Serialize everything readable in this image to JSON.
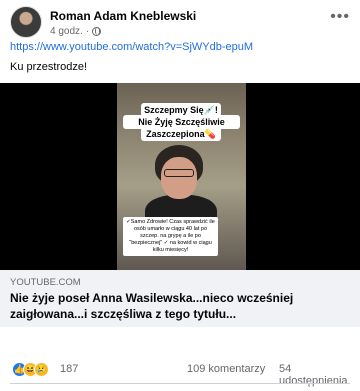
{
  "post": {
    "author": "Roman Adam Kneblewski",
    "time": "4 godz.",
    "separator": "·",
    "more_icon": "•••",
    "link_url": "https://www.youtube.com/watch?v=SjWYdb-epuM",
    "caption": "Ku przestrodze!"
  },
  "video": {
    "bubble_line1": "Szczepmy Się💉!",
    "bubble_line2": "Nie Żyję Szczęśliwie",
    "bubble_line3": "Zaszczepiona💊",
    "note_text": "✓Samo Zdrowie! Czas sprawdzić ile osób umarło w ciągu 40 lat po szczep. na grypę a ile po \"bezpiecznej\" ✓ na kowid w ciągu kilku miesięcy!"
  },
  "link_preview": {
    "domain": "YOUTUBE.COM",
    "title": "Nie żyje poseł Anna Wasilewska...nieco wcześniej zaigłowana...i szczęśliwa z tego tytułu..."
  },
  "stats": {
    "reaction_count": "187",
    "comments": "109 komentarzy",
    "shares": "54 udostępnienia"
  },
  "icons": {
    "like": "👍",
    "haha": "😆",
    "sad": "😢"
  }
}
